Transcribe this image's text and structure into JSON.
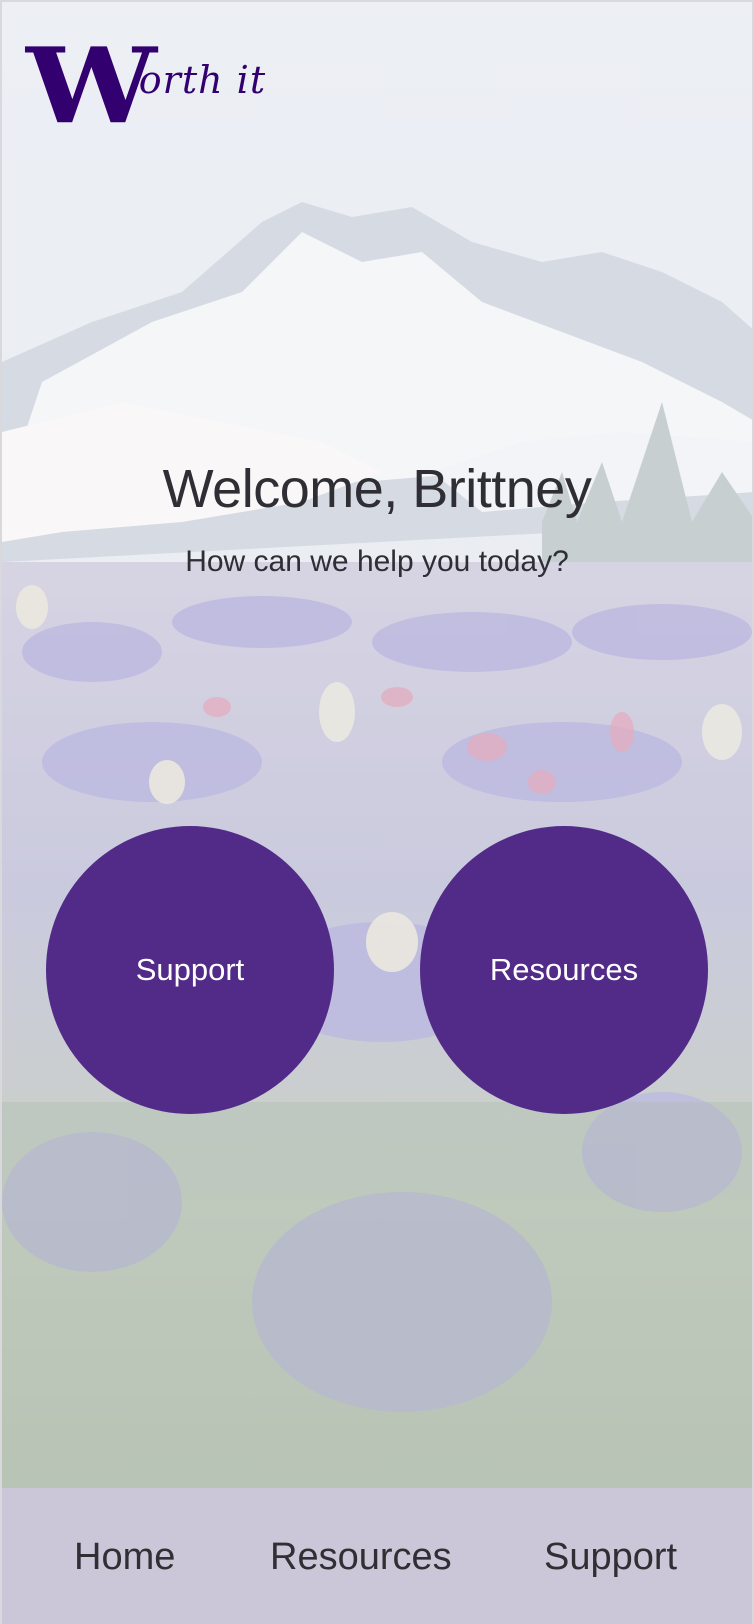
{
  "logo": {
    "letter": "W",
    "rest": "orth it"
  },
  "welcome": {
    "title": "Welcome, Brittney",
    "subtitle": "How can we help you today?"
  },
  "actions": {
    "left_label": "Support",
    "right_label": "Resources"
  },
  "nav": {
    "items": [
      {
        "label": "Home"
      },
      {
        "label": "Resources"
      },
      {
        "label": "Support"
      }
    ]
  },
  "colors": {
    "brand_purple": "#522b89",
    "logo_purple": "#33006f",
    "nav_background": "#cbc6d8",
    "text_dark": "#2e2e34"
  }
}
